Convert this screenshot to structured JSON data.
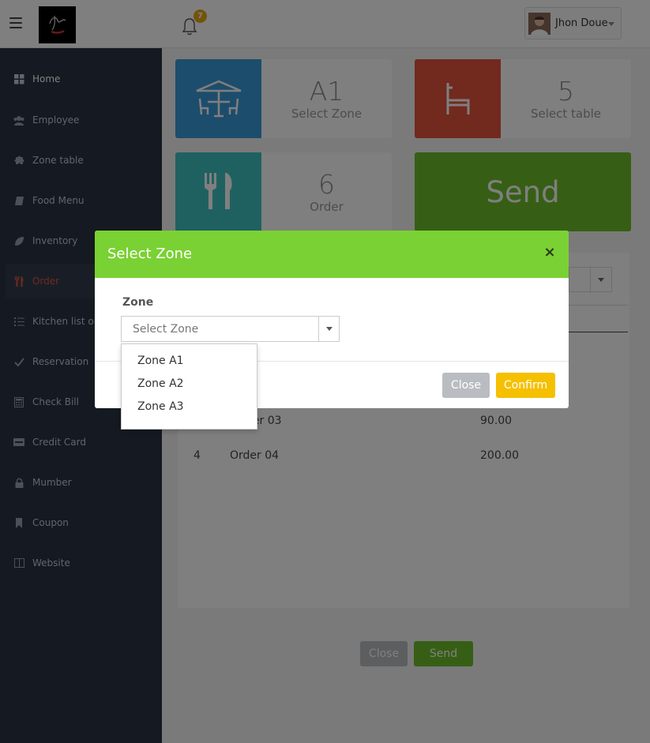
{
  "header": {
    "notification_count": "7",
    "user_name": "Jhon Doue"
  },
  "sidebar": {
    "items": [
      {
        "label": "Home",
        "icon": "grid-icon"
      },
      {
        "label": "Employee",
        "icon": "users-icon"
      },
      {
        "label": "Zone table",
        "icon": "puzzle-icon"
      },
      {
        "label": "Food Menu",
        "icon": "book-icon"
      },
      {
        "label": "Inventory",
        "icon": "leaf-icon"
      },
      {
        "label": "Order",
        "icon": "fork-knife-icon"
      },
      {
        "label": "Kitchen list order",
        "icon": "list-icon"
      },
      {
        "label": "Reservation",
        "icon": "check-icon"
      },
      {
        "label": "Check Bill",
        "icon": "calculator-icon"
      },
      {
        "label": "Credit Card",
        "icon": "visa-icon"
      },
      {
        "label": "Mumber",
        "icon": "lock-icon"
      },
      {
        "label": "Coupon",
        "icon": "bookmark-icon"
      },
      {
        "label": "Website",
        "icon": "columns-icon"
      }
    ],
    "active": "Order"
  },
  "tiles": {
    "zone": {
      "value": "A1",
      "caption": "Select Zone",
      "color": "#3a9bd9"
    },
    "table": {
      "value": "5",
      "caption": "Select table",
      "color": "#e5533d"
    },
    "order": {
      "value": "6",
      "caption": "Order",
      "color": "#3ec3c3"
    },
    "send_label": "Send"
  },
  "orders": [
    {
      "no": "4",
      "name": "Order 04",
      "price": "200.00"
    }
  ],
  "partial_row": {
    "name_visible": "der 03",
    "price": "90.00"
  },
  "footer": {
    "close_label": "Close",
    "send_label": "Send"
  },
  "modal": {
    "title": "Select Zone",
    "close_glyph": "×",
    "field_label": "Zone",
    "select_placeholder": "Select Zone",
    "options": [
      "Zone A1",
      "Zone A2",
      "Zone A3"
    ],
    "close_label": "Close",
    "confirm_label": "Confirm",
    "header_color": "#7ad133"
  }
}
